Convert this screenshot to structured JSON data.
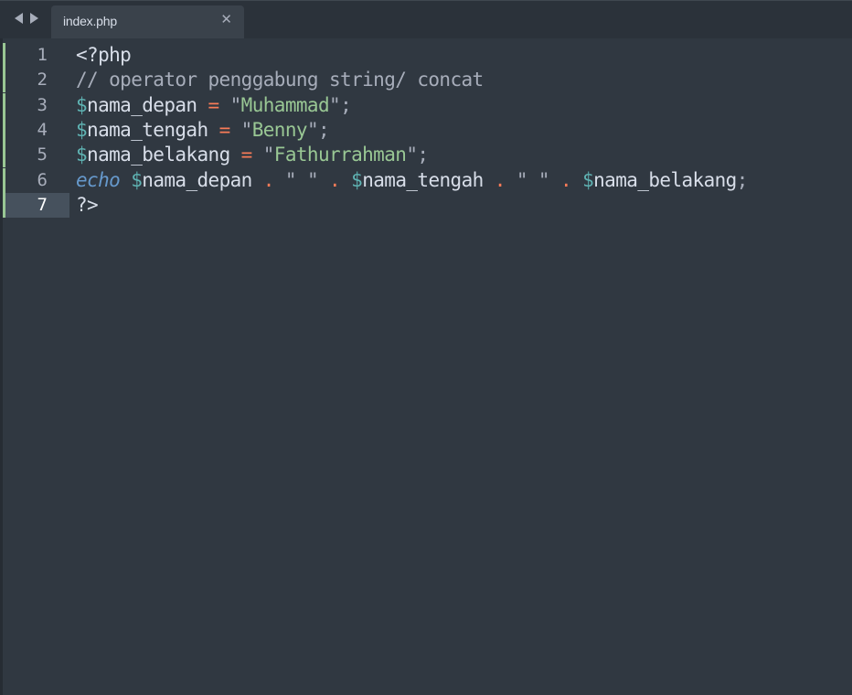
{
  "tab": {
    "filename": "index.php"
  },
  "icons": {
    "back": "chevron-left-icon",
    "forward": "chevron-right-icon",
    "close": "close-icon",
    "close_glyph": "✕"
  },
  "colors": {
    "background": "#303841",
    "comment": "#a7adba",
    "variable": "#5fb3b3",
    "operator": "#f97b58",
    "string": "#99c794",
    "keyword": "#6699cc",
    "modified_marker": "#99c794"
  },
  "editor": {
    "active_line": 7,
    "lines": [
      {
        "number": "1",
        "tokens": [
          {
            "t": "<?php",
            "c": "plain"
          }
        ]
      },
      {
        "number": "2",
        "tokens": [
          {
            "t": "// operator penggabung string/ concat",
            "c": "comment"
          }
        ]
      },
      {
        "number": "3",
        "tokens": [
          {
            "t": "$",
            "c": "var"
          },
          {
            "t": "nama_depan ",
            "c": "plain"
          },
          {
            "t": "=",
            "c": "op"
          },
          {
            "t": " ",
            "c": "plain"
          },
          {
            "t": "\"",
            "c": "punc"
          },
          {
            "t": "Muhammad",
            "c": "str"
          },
          {
            "t": "\"",
            "c": "punc"
          },
          {
            "t": ";",
            "c": "punc"
          }
        ]
      },
      {
        "number": "4",
        "tokens": [
          {
            "t": "$",
            "c": "var"
          },
          {
            "t": "nama_tengah ",
            "c": "plain"
          },
          {
            "t": "=",
            "c": "op"
          },
          {
            "t": " ",
            "c": "plain"
          },
          {
            "t": "\"",
            "c": "punc"
          },
          {
            "t": "Benny",
            "c": "str"
          },
          {
            "t": "\"",
            "c": "punc"
          },
          {
            "t": ";",
            "c": "punc"
          }
        ]
      },
      {
        "number": "5",
        "tokens": [
          {
            "t": "$",
            "c": "var"
          },
          {
            "t": "nama_belakang ",
            "c": "plain"
          },
          {
            "t": "=",
            "c": "op"
          },
          {
            "t": " ",
            "c": "plain"
          },
          {
            "t": "\"",
            "c": "punc"
          },
          {
            "t": "Fathurrahman",
            "c": "str"
          },
          {
            "t": "\"",
            "c": "punc"
          },
          {
            "t": ";",
            "c": "punc"
          }
        ]
      },
      {
        "number": "6",
        "tokens": [
          {
            "t": "echo",
            "c": "kw"
          },
          {
            "t": " ",
            "c": "plain"
          },
          {
            "t": "$",
            "c": "var"
          },
          {
            "t": "nama_depan ",
            "c": "plain"
          },
          {
            "t": ".",
            "c": "op"
          },
          {
            "t": " ",
            "c": "plain"
          },
          {
            "t": "\" \"",
            "c": "punc"
          },
          {
            "t": " ",
            "c": "plain"
          },
          {
            "t": ".",
            "c": "op"
          },
          {
            "t": " ",
            "c": "plain"
          },
          {
            "t": "$",
            "c": "var"
          },
          {
            "t": "nama_tengah ",
            "c": "plain"
          },
          {
            "t": ".",
            "c": "op"
          },
          {
            "t": " ",
            "c": "plain"
          },
          {
            "t": "\" \"",
            "c": "punc"
          },
          {
            "t": " ",
            "c": "plain"
          },
          {
            "t": ".",
            "c": "op"
          },
          {
            "t": " ",
            "c": "plain"
          },
          {
            "t": "$",
            "c": "var"
          },
          {
            "t": "nama_belakang",
            "c": "plain"
          },
          {
            "t": ";",
            "c": "punc"
          }
        ]
      },
      {
        "number": "7",
        "tokens": [
          {
            "t": "?>",
            "c": "plain"
          }
        ]
      }
    ]
  }
}
